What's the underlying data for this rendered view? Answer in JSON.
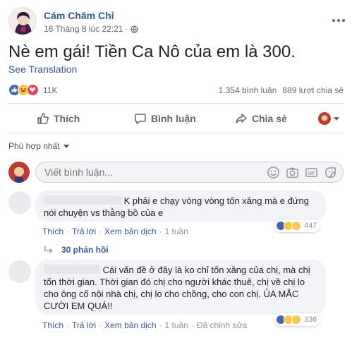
{
  "post": {
    "author": "Cám Chăm Chỉ",
    "timestamp": "16 Tháng 8 lúc 22:21",
    "separator": "·",
    "more_icon": "more-horizontal-icon",
    "text": "Nè em gái! Tiền Ca Nô của em là 300.",
    "see_translation": "See Translation"
  },
  "stats": {
    "reactions_count": "11K",
    "comments": "1.354 bình luận",
    "shares": "889 lượt chia sẻ"
  },
  "actions": {
    "like": "Thích",
    "comment": "Bình luận",
    "share": "Chia sẻ"
  },
  "sort": {
    "label": "Phù hợp nhất"
  },
  "composer": {
    "placeholder": "Viết bình luận..."
  },
  "comments": [
    {
      "text": "K phải e chạy vòng vòng tốn xăng mà e đứng nói chuyện vs thằng bồ của e",
      "like": "Thích",
      "reply": "Trả lời",
      "translate": "Xem bản dịch",
      "time": "1 tuần",
      "reactions": "447",
      "replies_label": "30 phản hồi"
    },
    {
      "text": "Cái vấn đề ở đây là ko chỉ tốn xăng của chị, mà chị tốn thời gian. Thời gian đó chị cho người khác thuê, chị về chị lo cho ông cố nội nhà chị, chị lo cho chồng, cho con chị. ỦA MẮC CƯỜI EM QUÁ!!",
      "like": "Thích",
      "reply": "Trả lời",
      "translate": "Xem bản dịch",
      "time": "1 tuần",
      "edited": "Đã chỉnh sửa",
      "reactions": "336"
    }
  ],
  "colors": {
    "link": "#385898",
    "like_blue": "#4267b2",
    "love_red": "#f33e58",
    "haha_yellow": "#fcc840",
    "text_muted": "#616770"
  }
}
